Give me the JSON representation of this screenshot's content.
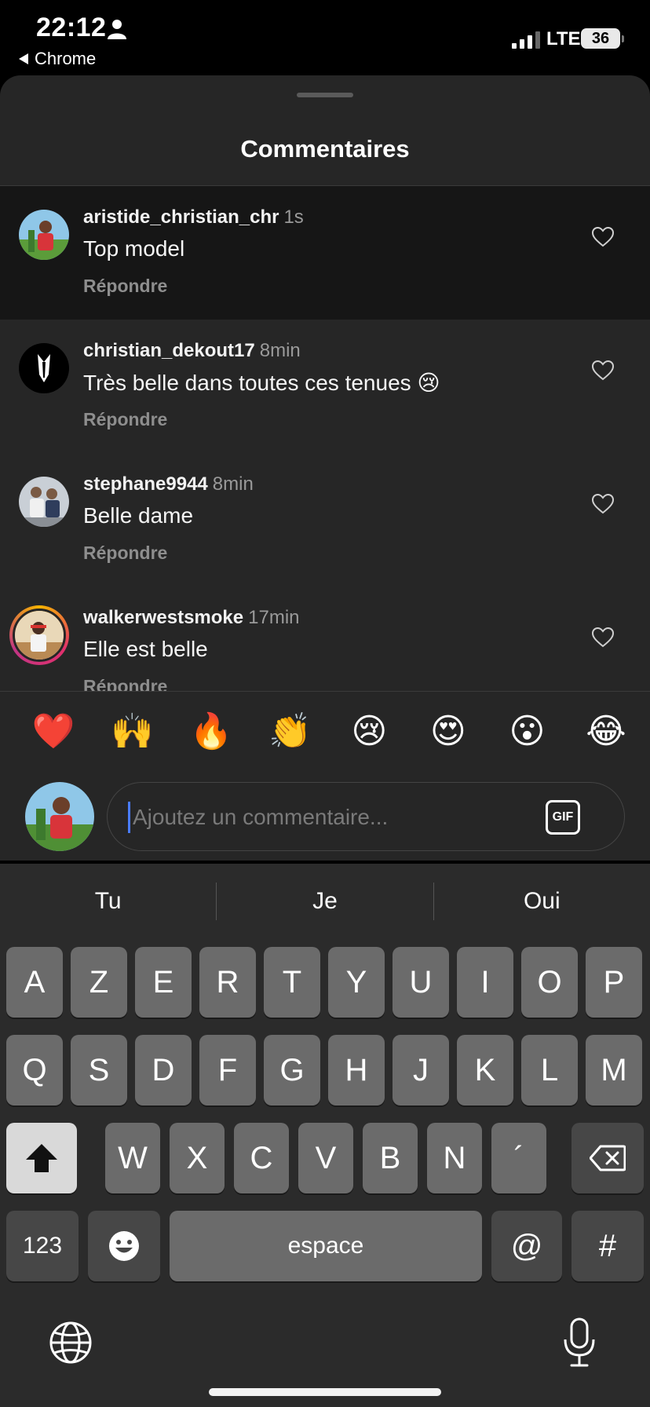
{
  "status_bar": {
    "time": "22:12",
    "back_app": "Chrome",
    "network": "LTE",
    "battery": "36"
  },
  "sheet": {
    "title": "Commentaires"
  },
  "comments": [
    {
      "username": "aristide_christian_chr",
      "time": "1s",
      "text": "Top model",
      "reply": "Répondre"
    },
    {
      "username": "christian_dekout17",
      "time": "8min",
      "text": "Très belle dans toutes ces tenues 😢",
      "reply": "Répondre"
    },
    {
      "username": "stephane9944",
      "time": "8min",
      "text": "Belle dame",
      "reply": "Répondre"
    },
    {
      "username": "walkerwestsmoke",
      "time": "17min",
      "text": "Elle est belle",
      "reply": "Répondre"
    }
  ],
  "emoji_bar": [
    "❤️",
    "🙌",
    "🔥",
    "👏",
    "😢",
    "😍",
    "😮",
    "😂"
  ],
  "composer": {
    "placeholder": "Ajoutez un commentaire...",
    "gif_label": "GIF"
  },
  "keyboard": {
    "suggestions": [
      "Tu",
      "Je",
      "Oui"
    ],
    "row1": [
      "A",
      "Z",
      "E",
      "R",
      "T",
      "Y",
      "U",
      "I",
      "O",
      "P"
    ],
    "row2": [
      "Q",
      "S",
      "D",
      "F",
      "G",
      "H",
      "J",
      "K",
      "L",
      "M"
    ],
    "row3": [
      "W",
      "X",
      "C",
      "V",
      "B",
      "N",
      "´"
    ],
    "numbers_label": "123",
    "space_label": "espace",
    "at_label": "@",
    "hash_label": "#"
  }
}
